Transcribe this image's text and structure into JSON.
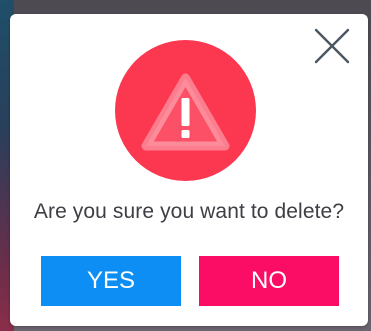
{
  "dialog": {
    "message": "Are you sure you want to delete?",
    "icon": "warning-triangle-icon",
    "close_icon": "close-icon"
  },
  "buttons": {
    "yes_label": "YES",
    "no_label": "NO"
  },
  "colors": {
    "warning_circle": "#fb3850",
    "yes_button": "#0d8ef5",
    "no_button": "#fb0d66",
    "text": "#3e3e46"
  }
}
